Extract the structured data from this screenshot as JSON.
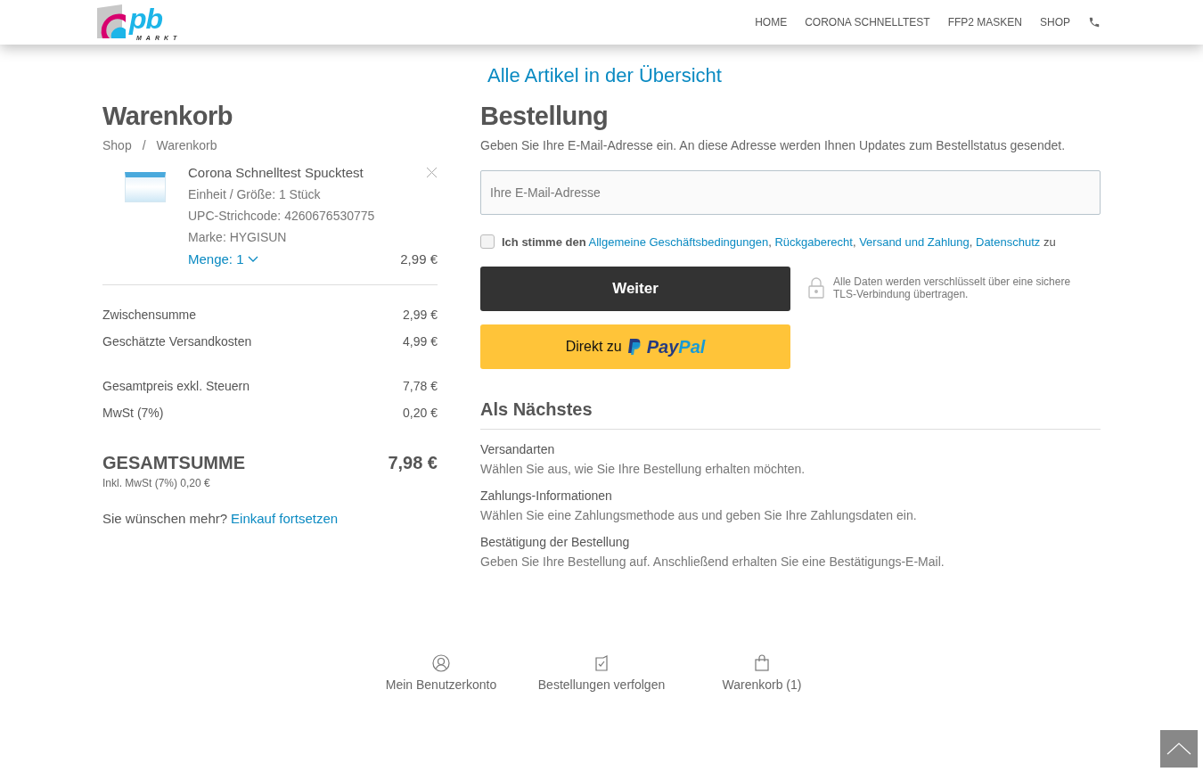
{
  "header": {
    "logo": {
      "letters": "pb",
      "word": "MARKT"
    },
    "nav": [
      {
        "label": "HOME",
        "kind": "text"
      },
      {
        "label": "CORONA SCHNELLTEST",
        "kind": "text"
      },
      {
        "label": "FFP2 MASKEN",
        "kind": "text"
      },
      {
        "label": "SHOP",
        "kind": "text"
      },
      {
        "kind": "phone"
      }
    ]
  },
  "overview_link": "Alle Artikel in der Übersicht",
  "cart": {
    "title": "Warenkorb",
    "breadcrumb": [
      "Shop",
      "Warenkorb"
    ],
    "breadcrumb_separator": "/",
    "item": {
      "name": "Corona Schnelltest Spucktest",
      "details": [
        "Einheit / Größe: 1 Stück",
        "UPC-Strichcode: 4260676530775",
        "Marke: HYGISUN"
      ],
      "quantity": "Menge: 1",
      "price": "2,99 €"
    },
    "summary_groups": [
      [
        {
          "label": "Zwischensumme",
          "value": "2,99 €"
        },
        {
          "label": "Geschätzte Versandkosten",
          "value": "4,99 €"
        }
      ],
      [
        {
          "label": "Gesamtpreis exkl. Steuern",
          "value": "7,78 €"
        },
        {
          "label": "MwSt (7%)",
          "value": "0,20 €"
        }
      ]
    ],
    "total": {
      "label": "GESAMTSUMME",
      "value": "7,98 €",
      "note": "Inkl. MwSt (7%) 0,20 €"
    },
    "more": {
      "text": "Sie wünschen mehr?",
      "link": "Einkauf fortsetzen"
    }
  },
  "order": {
    "title": "Bestellung",
    "intro": "Geben Sie Ihre E-Mail-Adresse ein. An diese Adresse werden Ihnen Updates zum Bestellstatus gesendet.",
    "email": {
      "placeholder": "Ihre E-Mail-Adresse"
    },
    "terms": {
      "checked": false,
      "lead": "Ich stimme den",
      "links": [
        "Allgemeine Geschäftsbedingungen",
        "Rückgaberecht",
        "Versand und Zahlung",
        "Datenschutz"
      ],
      "link_separator": ",",
      "tail": "zu"
    },
    "continue_button": "Weiter",
    "secure_note": "Alle Daten werden verschlüsselt über eine sichere TLS-Verbindung übertragen.",
    "paypal": {
      "prefix": "Direkt zu",
      "pay": "Pay",
      "pal": "Pal"
    },
    "next": {
      "title": "Als Nächstes",
      "steps": [
        {
          "title": "Versandarten",
          "text": "Wählen Sie aus, wie Sie Ihre Bestellung erhalten möchten."
        },
        {
          "title": "Zahlungs-Informationen",
          "text": "Wählen Sie eine Zahlungsmethode aus und geben Sie Ihre Zahlungsdaten ein."
        },
        {
          "title": "Bestätigung der Bestellung",
          "text": "Geben Sie Ihre Bestellung auf. Anschließend erhalten Sie eine Bestätigungs-E-Mail."
        }
      ]
    }
  },
  "footer_links": [
    {
      "kind": "account",
      "label": "Mein Benutzerkonto"
    },
    {
      "kind": "orders",
      "label": "Bestellungen verfolgen"
    },
    {
      "kind": "cart",
      "label": "Warenkorb (1)"
    }
  ]
}
